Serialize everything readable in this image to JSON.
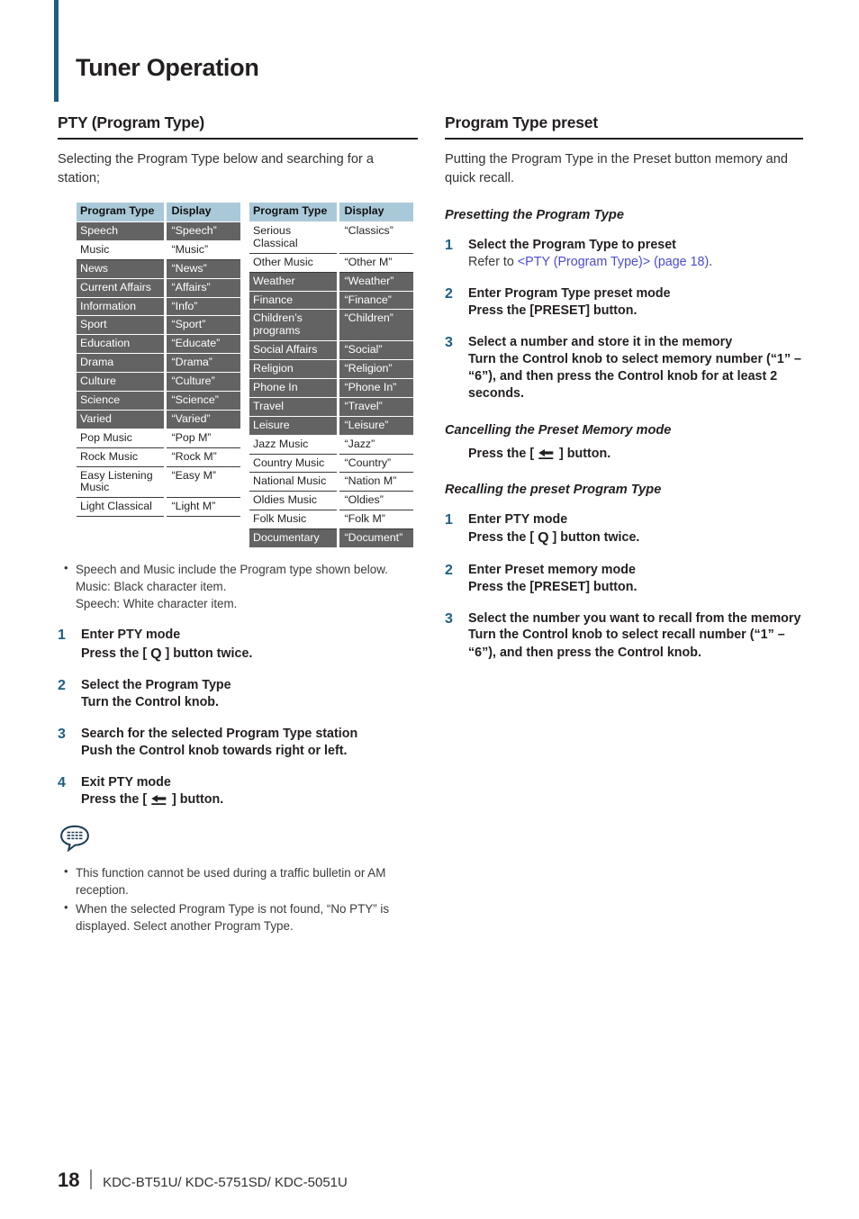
{
  "chapter": {
    "title": "Tuner Operation"
  },
  "left": {
    "section_title": "PTY (Program Type)",
    "lead": "Selecting the Program Type below and searching for a station;",
    "table_headers": {
      "type": "Program Type",
      "display": "Display"
    },
    "table1": [
      {
        "type": "Speech",
        "display": "“Speech”",
        "style": "dark"
      },
      {
        "type": "Music",
        "display": "“Music”",
        "style": "light"
      },
      {
        "type": "News",
        "display": "“News”",
        "style": "dark"
      },
      {
        "type": "Current Affairs",
        "display": "“Affairs”",
        "style": "dark"
      },
      {
        "type": "Information",
        "display": "“Info”",
        "style": "dark"
      },
      {
        "type": "Sport",
        "display": "“Sport”",
        "style": "dark"
      },
      {
        "type": "Education",
        "display": "“Educate”",
        "style": "dark"
      },
      {
        "type": "Drama",
        "display": "“Drama”",
        "style": "dark"
      },
      {
        "type": "Culture",
        "display": "“Culture”",
        "style": "dark"
      },
      {
        "type": "Science",
        "display": "“Science”",
        "style": "dark"
      },
      {
        "type": "Varied",
        "display": "“Varied”",
        "style": "dark"
      },
      {
        "type": "Pop Music",
        "display": "“Pop M”",
        "style": "light"
      },
      {
        "type": "Rock Music",
        "display": "“Rock M”",
        "style": "light"
      },
      {
        "type": "Easy Listening Music",
        "display": "“Easy M”",
        "style": "light"
      },
      {
        "type": "Light Classical",
        "display": "“Light M”",
        "style": "light"
      }
    ],
    "table2": [
      {
        "type": "Serious Classical",
        "display": "“Classics”",
        "style": "light"
      },
      {
        "type": "Other Music",
        "display": "“Other M”",
        "style": "light"
      },
      {
        "type": "Weather",
        "display": "“Weather”",
        "style": "dark"
      },
      {
        "type": "Finance",
        "display": "“Finance”",
        "style": "dark"
      },
      {
        "type": "Children’s programs",
        "display": "“Children”",
        "style": "dark"
      },
      {
        "type": "Social Affairs",
        "display": "“Social”",
        "style": "dark"
      },
      {
        "type": "Religion",
        "display": "“Religion”",
        "style": "dark"
      },
      {
        "type": "Phone In",
        "display": "“Phone In”",
        "style": "dark"
      },
      {
        "type": "Travel",
        "display": "“Travel”",
        "style": "dark"
      },
      {
        "type": "Leisure",
        "display": "“Leisure”",
        "style": "dark"
      },
      {
        "type": "Jazz Music",
        "display": "“Jazz”",
        "style": "light"
      },
      {
        "type": "Country Music",
        "display": "“Country”",
        "style": "light"
      },
      {
        "type": "National Music",
        "display": "“Nation M”",
        "style": "light"
      },
      {
        "type": "Oldies Music",
        "display": "“Oldies”",
        "style": "light"
      },
      {
        "type": "Folk Music",
        "display": "“Folk M”",
        "style": "light"
      },
      {
        "type": "Documentary",
        "display": "“Document”",
        "style": "dark"
      }
    ],
    "table_notes": [
      "Speech and Music include the Program type shown below.",
      "Music: Black character item.",
      "Speech: White character item."
    ],
    "steps": [
      {
        "num": "1",
        "title": "Enter PTY mode",
        "body_pre": "Press the [ ",
        "icon": "q-search-icon",
        "body_post": " ] button twice."
      },
      {
        "num": "2",
        "title": "Select the Program Type",
        "body_pre": "Turn the Control knob.",
        "icon": "",
        "body_post": ""
      },
      {
        "num": "3",
        "title": "Search for the selected Program Type station",
        "body_pre": "Push the Control knob towards right or left.",
        "icon": "",
        "body_post": ""
      },
      {
        "num": "4",
        "title": "Exit PTY mode",
        "body_pre": "Press the [ ",
        "icon": "back-arrow-icon",
        "body_post": " ] button."
      }
    ],
    "footnotes": [
      "This function cannot be used during a traffic bulletin or AM reception.",
      "When the selected Program Type is not found, “No PTY” is displayed. Select another Program Type."
    ]
  },
  "right": {
    "section_title": "Program Type preset",
    "lead": "Putting the Program Type in the Preset button memory and quick recall.",
    "sub1_title": "Presetting the Program Type",
    "sub1_steps": [
      {
        "num": "1",
        "title": "Select the Program Type to preset",
        "body_pre": "Refer to ",
        "link": "<PTY (Program Type)> (page 18)",
        "body_post": "."
      },
      {
        "num": "2",
        "title": "Enter Program Type preset mode",
        "body_pre": "Press the [PRESET] button.",
        "link": "",
        "body_post": ""
      },
      {
        "num": "3",
        "title": "Select a number and store it in the memory",
        "body_pre": "Turn the Control knob to select memory number (“1” – “6”), and then press the Control knob for at least 2 seconds.",
        "link": "",
        "body_post": ""
      }
    ],
    "sub2_title": "Cancelling the Preset Memory mode",
    "sub2_body_pre": "Press the [ ",
    "sub2_icon": "back-arrow-icon",
    "sub2_body_post": " ] button.",
    "sub3_title": "Recalling the preset Program Type",
    "sub3_steps": [
      {
        "num": "1",
        "title": "Enter PTY mode",
        "body_pre": "Press the [ ",
        "icon": "q-search-icon",
        "body_post": " ] button twice."
      },
      {
        "num": "2",
        "title": "Enter Preset memory mode",
        "body_pre": "Press the [PRESET] button.",
        "icon": "",
        "body_post": ""
      },
      {
        "num": "3",
        "title": "Select the number you want to recall from the memory",
        "body_pre": "Turn the Control knob to select recall number (“1” – “6”), and then press the Control knob.",
        "icon": "",
        "body_post": ""
      }
    ]
  },
  "footer": {
    "page_number": "18",
    "models": "KDC-BT51U/ KDC-5751SD/ KDC-5051U"
  },
  "icons": {
    "q_glyph": "Q",
    "note_icon": "note-bubble-icon"
  },
  "colors": {
    "accent": "#1d5f7f",
    "table_header": "#a9c9d9",
    "table_dark_row": "#636363",
    "link": "#4b4bd6"
  }
}
